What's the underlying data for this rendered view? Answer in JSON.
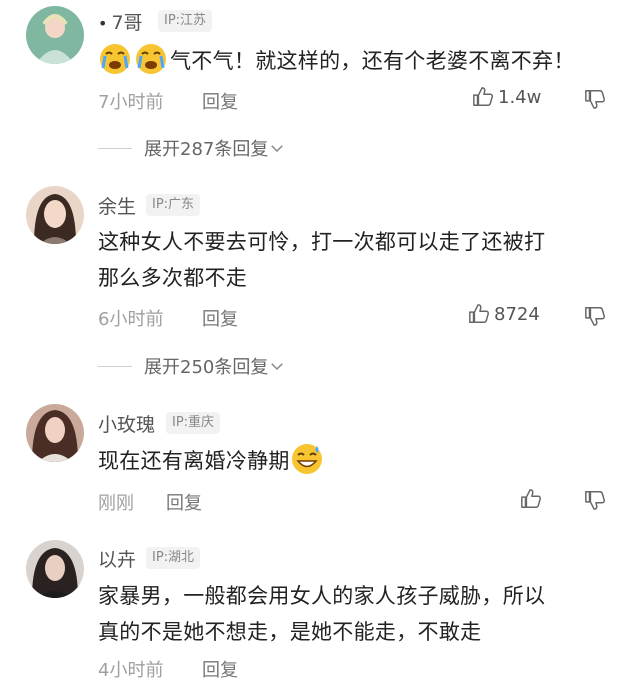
{
  "comments": [
    {
      "name": "7哥",
      "ip": "IP:江苏",
      "text": "气不气！就这样的，还有个老婆不离不弃！",
      "time": "7小时前",
      "reply_label": "回复",
      "likes": "1.4w",
      "expand": "展开287条回复"
    },
    {
      "name": "余生",
      "ip": "IP:广东",
      "text_line1": "这种女人不要去可怜，打一次都可以走了还被打",
      "text_line2": "那么多次都不走",
      "time": "6小时前",
      "reply_label": "回复",
      "likes": "8724",
      "expand": "展开250条回复"
    },
    {
      "name": "小玫瑰",
      "ip": "IP:重庆",
      "text": "现在还有离婚冷静期",
      "time": "刚刚",
      "reply_label": "回复"
    },
    {
      "name": "以卉",
      "ip": "IP:湖北",
      "text_line1": "家暴男，一般都会用女人的家人孩子威胁，所以",
      "text_line2": "真的不是她不想走，是她不能走，不敢走",
      "time": "4小时前",
      "reply_label": "回复"
    }
  ],
  "icons": {
    "like": "thumb-up-icon",
    "dislike": "thumb-down-icon",
    "chevron": "chevron-down-icon"
  },
  "colors": {
    "text": "#222222",
    "meta": "#a0a0a0",
    "tag_bg": "#f2f2f2"
  }
}
